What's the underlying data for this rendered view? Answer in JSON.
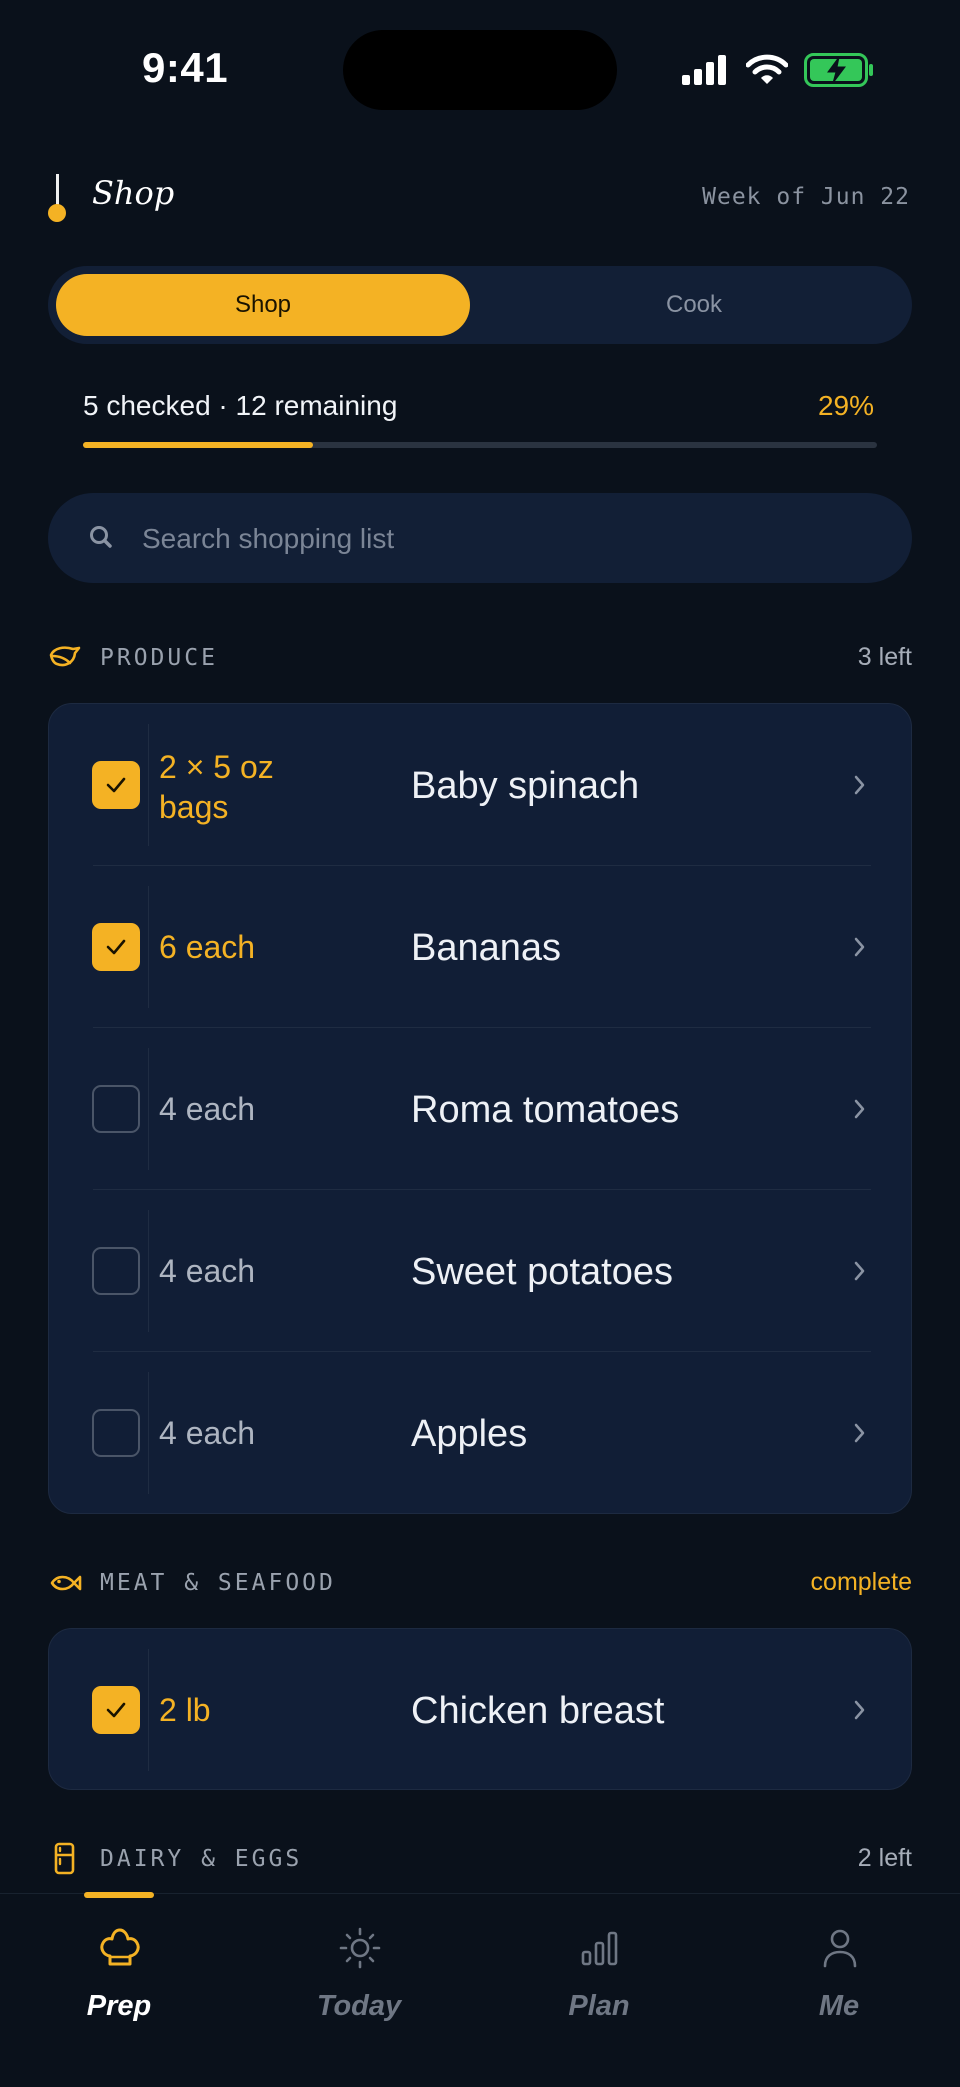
{
  "status_bar": {
    "time": "9:41"
  },
  "header": {
    "title": "Shop",
    "week": "Week of Jun 22"
  },
  "segments": {
    "shop": "Shop",
    "cook": "Cook"
  },
  "progress": {
    "summary": "5 checked · 12 remaining",
    "percent_label": "29%",
    "fraction": 0.29
  },
  "search": {
    "placeholder": "Search shopping list",
    "value": ""
  },
  "sections": [
    {
      "title": "PRODUCE",
      "count": "3 left",
      "icon": "leaf-icon",
      "items": [
        {
          "qty": [
            "2 × 5 oz",
            "bags"
          ],
          "name": "Baby spinach",
          "checked": true
        },
        {
          "qty": [
            "6 each"
          ],
          "name": "Bananas",
          "checked": true
        },
        {
          "qty": [
            "4 each"
          ],
          "name": "Roma tomatoes",
          "checked": false
        },
        {
          "qty": [
            "4 each"
          ],
          "name": "Sweet potatoes",
          "checked": false
        },
        {
          "qty": [
            "4 each"
          ],
          "name": "Apples",
          "checked": false
        }
      ]
    },
    {
      "title": "MEAT & SEAFOOD",
      "count": "complete",
      "icon": "fish-icon",
      "items": [
        {
          "qty": [
            "2 lb"
          ],
          "name": "Chicken breast",
          "checked": true
        }
      ]
    },
    {
      "title": "DAIRY & EGGS",
      "count": "2 left",
      "icon": "fridge-icon",
      "items": []
    }
  ],
  "tabs": [
    {
      "label": "Prep",
      "icon": "chef-hat-icon",
      "active": true
    },
    {
      "label": "Today",
      "icon": "sun-icon",
      "active": false
    },
    {
      "label": "Plan",
      "icon": "bar-chart-icon",
      "active": false
    },
    {
      "label": "Me",
      "icon": "person-icon",
      "active": false
    }
  ],
  "colors": {
    "accent": "#f4b224",
    "background": "#0a111b",
    "card": "#111e36"
  }
}
